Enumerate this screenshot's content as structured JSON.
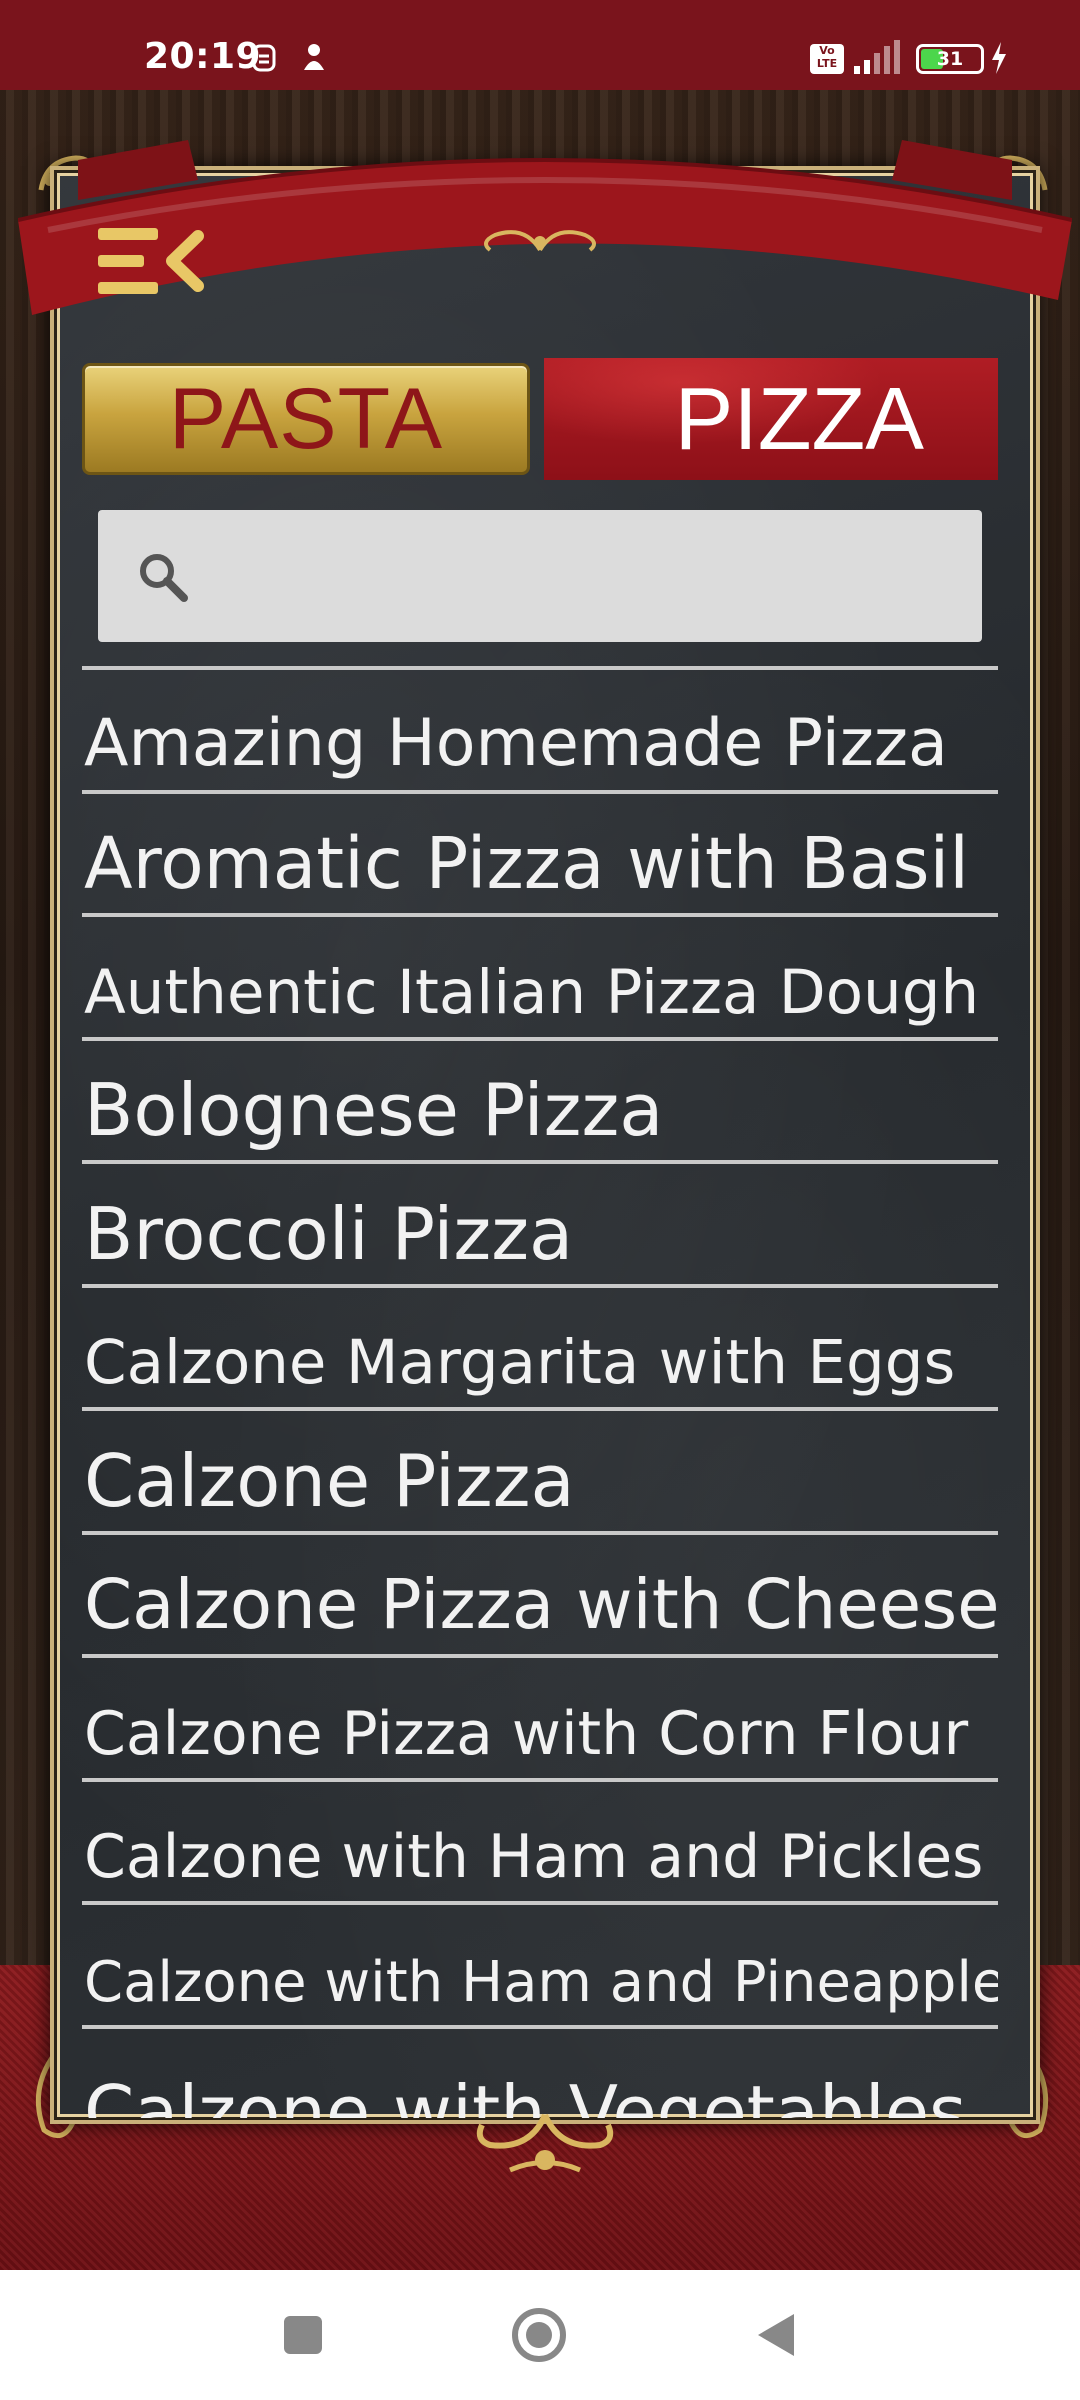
{
  "status_bar": {
    "time": "20:19",
    "battery_level": "31",
    "signal_label": "LTE"
  },
  "tabs": [
    {
      "label": "PASTA",
      "selected": false
    },
    {
      "label": "PIZZA",
      "selected": true
    }
  ],
  "search": {
    "value": "",
    "placeholder": ""
  },
  "recipes": [
    "Amazing Homemade Pizza",
    "Aromatic Pizza with Basil",
    "Authentic Italian Pizza Dough",
    "Bolognese Pizza",
    "Broccoli Pizza",
    "Calzone Margarita with Eggs",
    "Calzone Pizza",
    "Calzone Pizza with Cheese",
    "Calzone Pizza with Corn Flour",
    "Calzone with Ham and Pickles",
    "Calzone with Ham and Pineapple",
    "Calzone with Vegetables"
  ],
  "colors": {
    "accent_red": "#8d1018",
    "gold": "#c9a43f",
    "menu_icon": "#e8c766",
    "status_bar": "#7a141c"
  },
  "icons": {
    "menu": "menu-collapse-icon",
    "search": "search-icon",
    "nav_recents": "square-icon",
    "nav_home": "circle-icon",
    "nav_back": "triangle-back-icon"
  }
}
